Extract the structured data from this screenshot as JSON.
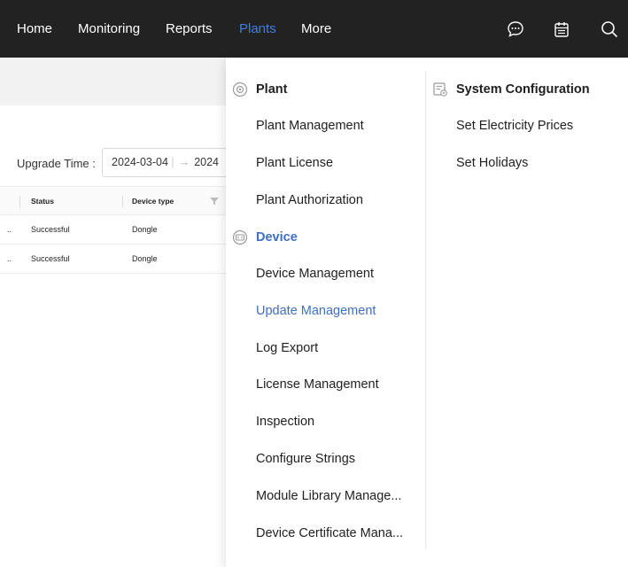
{
  "nav": {
    "items": [
      {
        "label": "Home"
      },
      {
        "label": "Monitoring"
      },
      {
        "label": "Reports"
      },
      {
        "label": "Plants"
      },
      {
        "label": "More"
      }
    ],
    "active": "Plants",
    "icons": [
      "chat-icon",
      "calendar-icon",
      "search-icon"
    ]
  },
  "filter": {
    "upgrade_time_label": "Upgrade Time :",
    "date_start": "2024-03-04",
    "date_end": "2024"
  },
  "table": {
    "headers": {
      "status": "Status",
      "device_type": "Device type"
    },
    "rows": [
      {
        "prefix": "..",
        "status": "Successful",
        "device_type": "Dongle"
      },
      {
        "prefix": "..",
        "status": "Successful",
        "device_type": "Dongle"
      }
    ]
  },
  "dropdown": {
    "plant": {
      "title": "Plant",
      "items": [
        "Plant Management",
        "Plant License",
        "Plant Authorization"
      ]
    },
    "device": {
      "title": "Device",
      "items": [
        "Device Management",
        "Update Management",
        "Log Export",
        "License Management",
        "Inspection",
        "Configure Strings",
        "Module Library Manage...",
        "Device Certificate Mana..."
      ],
      "active_item": "Update Management"
    },
    "system": {
      "title": "System Configuration",
      "items": [
        "Set Electricity Prices",
        "Set Holidays"
      ]
    }
  },
  "colors": {
    "topbar": "#222222",
    "accent": "#3f6fc6",
    "nav_active": "#3f7de8"
  }
}
